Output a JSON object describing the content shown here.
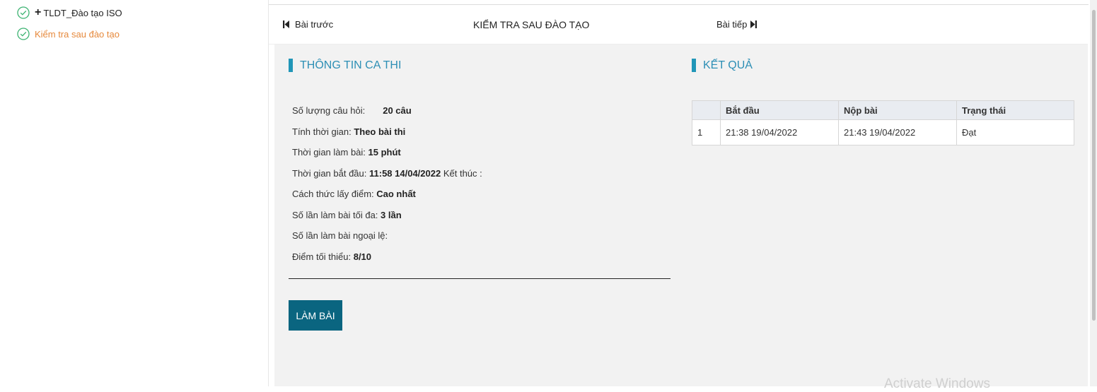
{
  "sidebar": {
    "items": [
      {
        "label": "TLDT_Đào tạo ISO",
        "icon": "check-circle-icon",
        "expand_icon": "plus-icon"
      },
      {
        "label": "Kiểm tra sau đào tạo",
        "icon": "check-circle-icon"
      }
    ]
  },
  "nav": {
    "prev_label": "Bài trước",
    "title": "KIỂM TRA SAU ĐÀO TẠO",
    "next_label": "Bài tiếp"
  },
  "info": {
    "heading": "THÔNG TIN CA THI",
    "rows": [
      {
        "label": "Số lượng câu hỏi:",
        "value": "20 câu"
      },
      {
        "label": "Tính thời gian:",
        "value": "Theo bài thi"
      },
      {
        "label": "Thời gian làm bài:",
        "value": "15 phút"
      },
      {
        "label": "Thời gian bắt đầu:",
        "value": "11:58 14/04/2022",
        "suffix": "Kết thúc :"
      },
      {
        "label": "Cách thức lấy điểm:",
        "value": "Cao nhất"
      },
      {
        "label": "Số lần làm bài tối đa:",
        "value": "3 lần"
      },
      {
        "label": "Số lần làm bài ngoại lệ:",
        "value": ""
      },
      {
        "label": "Điểm tối thiểu:",
        "value": "8/10"
      }
    ],
    "start_button": "LÀM BÀI"
  },
  "results": {
    "heading": "KẾT QUẢ",
    "columns": [
      "",
      "Bắt đầu",
      "Nộp bài",
      "Trạng thái"
    ],
    "rows": [
      [
        "1",
        "21:38 19/04/2022",
        "21:43 19/04/2022",
        "Đạt"
      ]
    ]
  },
  "watermark": "Activate Windows",
  "colors": {
    "accent": "#0a6580",
    "section_bar": "#2196b8",
    "section_text": "#2d8fb5",
    "active_item": "#e6893c",
    "check": "#3cb371"
  }
}
